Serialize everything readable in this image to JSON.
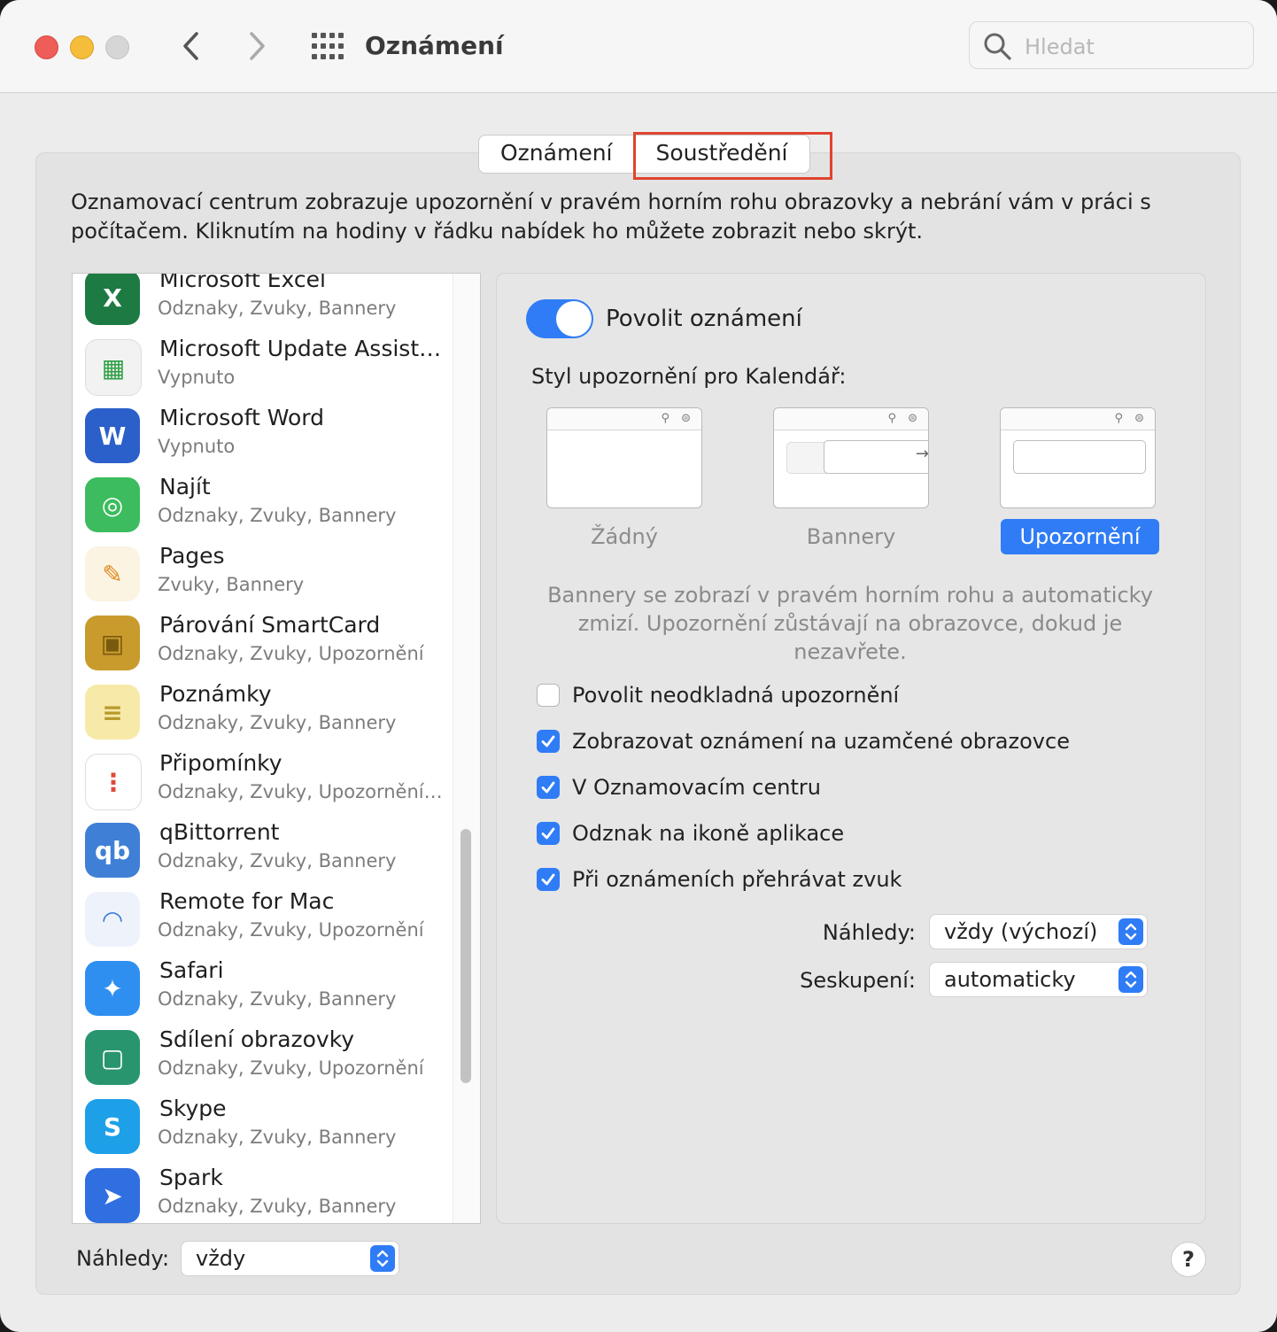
{
  "window": {
    "title": "Oznámení"
  },
  "search": {
    "placeholder": "Hledat"
  },
  "tabs": [
    "Oznámení",
    "Soustředění"
  ],
  "description": "Oznamovací centrum zobrazuje upozornění v pravém horním rohu obrazovky a nebrání vám v práci s počítačem. Kliknutím na hodiny v řádku nabídek ho můžete zobrazit nebo skrýt.",
  "apps": [
    {
      "name": "Microsoft Excel",
      "sub": "Odznaky, Zvuky, Bannery",
      "icon": "excel-icon"
    },
    {
      "name": "Microsoft Update Assist…",
      "sub": "Vypnuto",
      "icon": "microsoft-update-icon"
    },
    {
      "name": "Microsoft Word",
      "sub": "Vypnuto",
      "icon": "word-icon"
    },
    {
      "name": "Najít",
      "sub": "Odznaky, Zvuky, Bannery",
      "icon": "find-my-icon"
    },
    {
      "name": "Pages",
      "sub": "Zvuky, Bannery",
      "icon": "pages-icon"
    },
    {
      "name": "Párování SmartCard",
      "sub": "Odznaky, Zvuky, Upozornění",
      "icon": "smartcard-icon"
    },
    {
      "name": "Poznámky",
      "sub": "Odznaky, Zvuky, Bannery",
      "icon": "notes-icon"
    },
    {
      "name": "Připomínky",
      "sub": "Odznaky, Zvuky, Upozornění…",
      "icon": "reminders-icon"
    },
    {
      "name": "qBittorrent",
      "sub": "Odznaky, Zvuky, Bannery",
      "icon": "qbittorrent-icon"
    },
    {
      "name": "Remote for Mac",
      "sub": "Odznaky, Zvuky, Upozornění",
      "icon": "remote-icon"
    },
    {
      "name": "Safari",
      "sub": "Odznaky, Zvuky, Bannery",
      "icon": "safari-icon"
    },
    {
      "name": "Sdílení obrazovky",
      "sub": "Odznaky, Zvuky, Upozornění",
      "icon": "screen-sharing-icon"
    },
    {
      "name": "Skype",
      "sub": "Odznaky, Zvuky, Bannery",
      "icon": "skype-icon"
    },
    {
      "name": "Spark",
      "sub": "Odznaky, Zvuky, Bannery",
      "icon": "spark-icon"
    }
  ],
  "right": {
    "allow_label": "Povolit oznámení",
    "allow_on": true,
    "style_label": "Styl upozornění pro Kalendář:",
    "styles": [
      "Žádný",
      "Bannery",
      "Upozornění"
    ],
    "selected_style": "Upozornění",
    "style_explain": "Bannery se zobrazí v pravém horním rohu a automaticky zmizí. Upozornění zůstávají na obrazovce, dokud je nezavřete.",
    "checkboxes": [
      {
        "label": "Povolit neodkladná upozornění",
        "checked": false
      },
      {
        "label": "Zobrazovat oznámení na uzamčené obrazovce",
        "checked": true
      },
      {
        "label": "V Oznamovacím centru",
        "checked": true
      },
      {
        "label": "Odznak na ikoně aplikace",
        "checked": true
      },
      {
        "label": "Při oznámeních přehrávat zvuk",
        "checked": true
      }
    ],
    "previews_label": "Náhledy:",
    "previews_value": "vždy (výchozí)",
    "grouping_label": "Seskupení:",
    "grouping_value": "automaticky"
  },
  "bottom": {
    "previews_label": "Náhledy:",
    "previews_value": "vždy"
  },
  "help": "?",
  "colors": {
    "accent": "#2f7cf6",
    "highlight": "#e0432f"
  }
}
